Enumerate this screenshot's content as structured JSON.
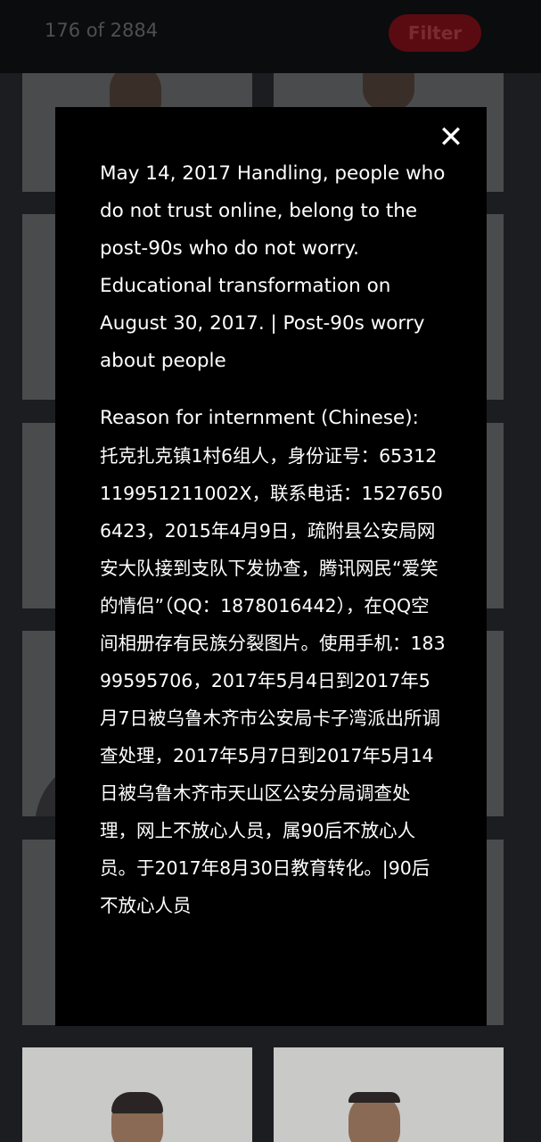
{
  "header": {
    "counter": "176 of 2884",
    "filter_label": "Filter"
  },
  "modal": {
    "close_icon": "close-icon",
    "caption": "May 14, 2017 Handling, people who do not trust online, belong to the post-90s who do not worry. Educational transformation on August 30, 2017. | Post-90s worry about people",
    "reason_title": "Reason for internment (Chinese):",
    "reason_text": "托克扎克镇1村6组人，身份证号：65312119951211002X，联系电话：15276506423，2015年4月9日，疏附县公安局网安大队接到支队下发协查，腾讯网民“爱笑的情侣”（QQ：1878016442），在QQ空间相册存有民族分裂图片。使用手机：18399595706，2017年5月4日到2017年5月7日被乌鲁木齐市公安局卡子湾派出所调查处理，2017年5月7日到2017年5月14日被乌鲁木齐市天山区公安分局调查处理，网上不放心人员，属90后不放心人员。于2017年8月30日教育转化。|90后不放心人员"
  },
  "colors": {
    "accent": "#5a0b12",
    "background": "#1a1b1d",
    "modal_bg": "#000000",
    "text": "#ffffff"
  }
}
